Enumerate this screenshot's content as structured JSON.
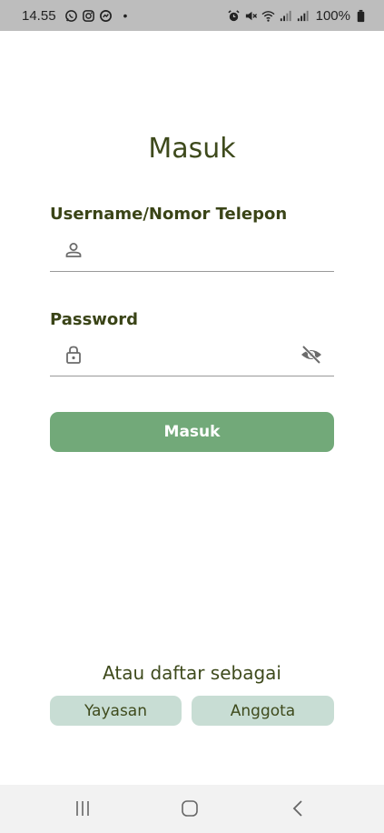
{
  "status_bar": {
    "time": "14.55",
    "battery": "100%",
    "left_icons": [
      "whatsapp-icon",
      "instagram-icon",
      "messenger-icon"
    ],
    "right_icons": [
      "alarm-icon",
      "mute-icon",
      "wifi-icon",
      "signal-icon",
      "signal-icon",
      "battery-icon"
    ]
  },
  "login": {
    "title": "Masuk",
    "username_label": "Username/Nomor Telepon",
    "username_value": "",
    "password_label": "Password",
    "password_value": "",
    "submit_label": "Masuk"
  },
  "register": {
    "prompt": "Atau daftar sebagai",
    "options": [
      "Yayasan",
      "Anggota"
    ]
  },
  "nav": {
    "buttons": [
      "recent-apps-icon",
      "home-icon",
      "back-icon"
    ]
  },
  "colors": {
    "primary_button": "#72a979",
    "secondary_button": "#c8ddd4",
    "text": "#3e4a1c",
    "status_bar": "#bdbdbd",
    "nav_bar": "#f2f2f2"
  }
}
